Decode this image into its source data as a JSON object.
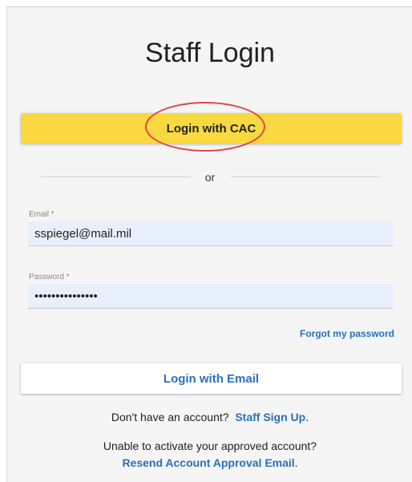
{
  "page": {
    "title": "Staff Login"
  },
  "cac_button": {
    "label": "Login with CAC"
  },
  "divider": {
    "text": "or"
  },
  "email": {
    "label": "Email *",
    "value": "sspiegel@mail.mil"
  },
  "password": {
    "label": "Password *",
    "value": "passwordvalue12"
  },
  "forgot": {
    "label": "Forgot my password"
  },
  "email_button": {
    "label": "Login with Email"
  },
  "signup": {
    "prompt": "Don't have an account?",
    "link": "Staff Sign Up",
    "suffix": "."
  },
  "activation": {
    "prompt": "Unable to activate your approved account?",
    "link": "Resend Account Approval Email",
    "suffix": "."
  },
  "colors": {
    "accent_yellow": "#f9d93f",
    "link_blue": "#2b6fbd",
    "highlight_red": "#e34348",
    "input_fill": "#e8f0fe"
  }
}
